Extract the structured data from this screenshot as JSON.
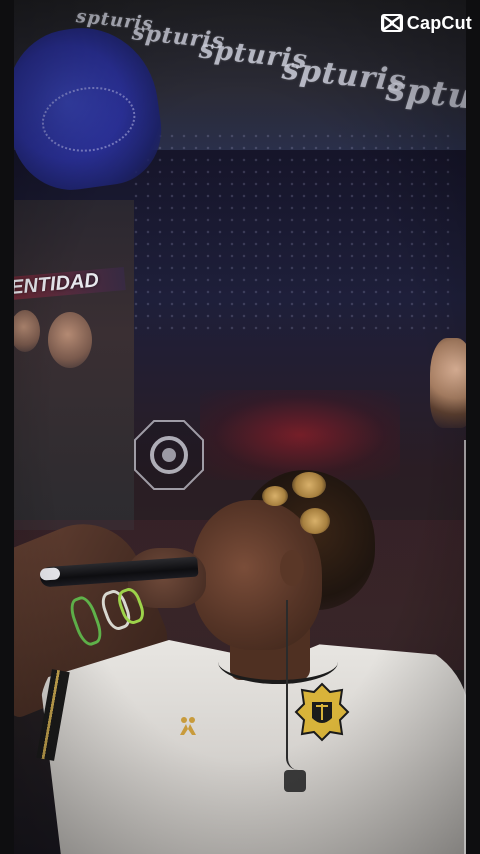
{
  "watermark": {
    "brand": "CapCut",
    "icon": "capcut-logo-icon"
  },
  "scene": {
    "sponsor_text": [
      "spturis",
      "spturis",
      "spturis",
      "spturis",
      "spturis"
    ],
    "shirt_text": "ENTIDAD",
    "overlay_icon": "camera-shutter-icon"
  },
  "colors": {
    "jersey": "#e2dfdb",
    "crest": "#d8b33a",
    "bandana": "#2b319a",
    "background": "#1b1b25"
  }
}
